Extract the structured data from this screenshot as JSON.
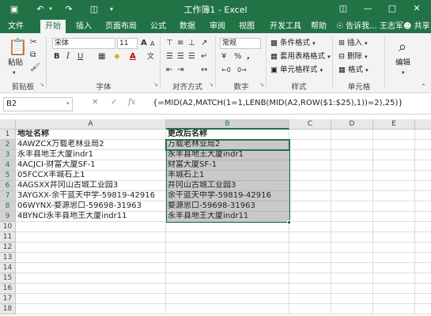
{
  "app": {
    "title": "工作簿1 - Excel",
    "qa_save_icon": "save-icon",
    "qa_undo_icon": "undo-icon",
    "qa_redo_icon": "redo-icon",
    "qa_preview_icon": "print-preview-icon",
    "qa_customize_icon": "customize-icon",
    "ribbon_display_icon": "ribbon-display-icon",
    "minimize_icon": "minimize-icon",
    "restore_icon": "restore-icon",
    "close_icon": "close-icon"
  },
  "tabs": [
    "文件",
    "开始",
    "插入",
    "页面布局",
    "公式",
    "数据",
    "审阅",
    "视图",
    "开发工具",
    "帮助"
  ],
  "tell_me": "告诉我...",
  "user": "王志军",
  "share": "共享",
  "ribbon": {
    "paste": "粘贴",
    "clipboard": "剪贴板",
    "font_name": "宋体",
    "font_size": "11",
    "bold": "B",
    "italic": "I",
    "underline": "U",
    "grow_font": "A",
    "shrink_font": "A",
    "font_color_glyph": "A",
    "font_group": "字体",
    "align_group": "对齐方式",
    "number_format": "常规",
    "percent": "%",
    "comma": ",",
    "number_group": "数字",
    "conditional": "条件格式",
    "table_format": "套用表格格式",
    "cell_styles": "单元格样式",
    "styles_group": "样式",
    "insert": "插入",
    "delete": "删除",
    "format": "格式",
    "cells_group": "单元格",
    "edit": "编辑"
  },
  "formula_bar": {
    "name_box": "B2",
    "cancel": "✕",
    "enter": "✓",
    "fx": "fx",
    "formula": "{=MID(A2,MATCH(1=1,LENB(MID(A2,ROW($1:$25),1))=2),25)}"
  },
  "grid": {
    "columns": [
      "A",
      "B",
      "C",
      "D",
      "E"
    ],
    "rows": [
      "1",
      "2",
      "3",
      "4",
      "5",
      "6",
      "7",
      "8",
      "9",
      "10",
      "11",
      "12",
      "13",
      "14",
      "15",
      "16",
      "17",
      "18"
    ],
    "data": [
      [
        "地址名称",
        "更改后名称"
      ],
      [
        "4AWZCX万载老林业局2",
        "万载老林业局2"
      ],
      [
        "永丰县地王大厦indr1",
        "永丰县地王大厦indr1"
      ],
      [
        "4ACJCI-财富大厦SF-1",
        "财富大厦SF-1"
      ],
      [
        "05FCCX丰城石上1",
        "丰城石上1"
      ],
      [
        "4AGSXX井冈山古城工业园3",
        "井冈山古城工业园3"
      ],
      [
        "3AYGXX-余干蓝天中学-59819-42916",
        "余干蓝天中学-59819-42916"
      ],
      [
        "06WYNX-婺源思口-59698-31963",
        "婺源思口-59698-31963"
      ],
      [
        "4BYNCI永丰县地王大厦indr11",
        "永丰县地王大厦indr11"
      ]
    ]
  }
}
